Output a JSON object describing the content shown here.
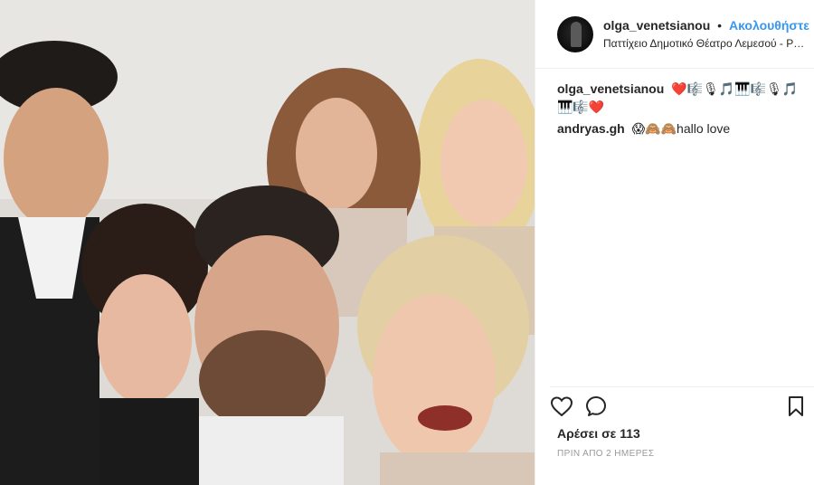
{
  "post": {
    "photo_alt": "Group selfie of six people"
  },
  "header": {
    "username": "olga_venetsianou",
    "separator": "•",
    "follow_label": "Ακολουθήστε",
    "location": "Παττίχειο Δημοτικό Θέατρο Λεμεσού - Pattichion Municipal Theatre Limassol"
  },
  "comments": [
    {
      "user": "olga_venetsianou",
      "text": "❤️🎼🎙🎵🎹🎼🎙🎵🎹🎼❤️"
    },
    {
      "user": "andryas.gh",
      "text": "😱🙈🙈hallo love"
    }
  ],
  "actions": {
    "like_icon": "heart-icon",
    "comment_icon": "comment-icon",
    "save_icon": "bookmark-icon"
  },
  "likes_text": "Αρέσει σε 113",
  "timestamp": "ΠΡΙΝ ΑΠΟ 2 ΗΜΕΡΕΣ",
  "colors": {
    "link": "#3897f0",
    "text": "#262626",
    "muted": "#999999",
    "border": "#efefef"
  }
}
